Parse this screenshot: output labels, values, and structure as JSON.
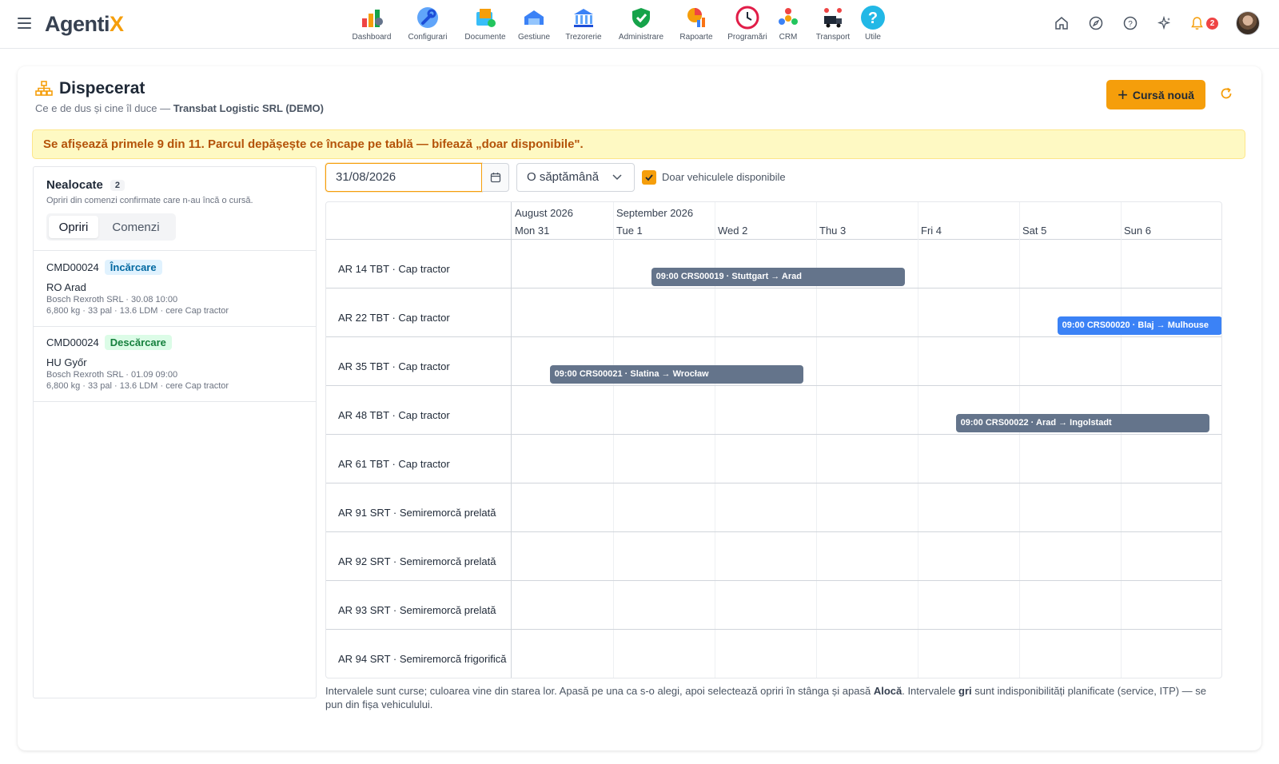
{
  "app": {
    "logo_main": "Agenti",
    "logo_accent": "X"
  },
  "modules": [
    {
      "label": "Dashboard",
      "icon": "dashboard-icon"
    },
    {
      "label": "Configurari",
      "icon": "wrench-icon"
    },
    {
      "label": "Documente",
      "icon": "documents-icon"
    },
    {
      "label": "Gestiune",
      "icon": "warehouse-icon"
    },
    {
      "label": "Trezorerie",
      "icon": "bank-icon"
    },
    {
      "label": "Administrare",
      "icon": "shield-icon"
    },
    {
      "label": "Rapoarte",
      "icon": "reports-icon"
    },
    {
      "label": "Programări",
      "icon": "clock-icon"
    },
    {
      "label": "CRM",
      "icon": "crm-icon"
    },
    {
      "label": "Transport",
      "icon": "truck-icon"
    },
    {
      "label": "Utile",
      "icon": "help-icon"
    }
  ],
  "header": {
    "notifications_count": "2"
  },
  "page": {
    "title": "Dispecerat",
    "subtitle_prefix": "Ce e de dus și cine îl duce — ",
    "subtitle_company": "Transbat Logistic SRL (DEMO)",
    "new_button": "Cursă nouă"
  },
  "warning": "Se afișează primele 9 din 11. Parcul depășește ce încape pe tablă — bifează „doar disponibile\".",
  "unassigned": {
    "title": "Nealocate",
    "count": "2",
    "subtitle": "Opriri din comenzi confirmate care n-au încă o cursă.",
    "tabs": [
      "Opriri",
      "Comenzi"
    ],
    "items": [
      {
        "code": "CMD00024",
        "tag": "Încărcare",
        "place": "RO Arad",
        "line1": "Bosch Rexroth SRL · 30.08 10:00",
        "line2": "6,800 kg · 33 pal · 13.6 LDM · cere Cap tractor"
      },
      {
        "code": "CMD00024",
        "tag": "Descărcare",
        "place": "HU Győr",
        "line1": "Bosch Rexroth SRL · 01.09 09:00",
        "line2": "6,800 kg · 33 pal · 13.6 LDM · cere Cap tractor"
      }
    ]
  },
  "toolbar": {
    "date_value": "31/08/2026",
    "range_value": "O săptămână",
    "available_only_label": "Doar vehiculele disponibile",
    "available_only_checked": true
  },
  "timeline": {
    "months": [
      {
        "label": "August 2026",
        "day_index": 0
      },
      {
        "label": "September 2026",
        "day_index": 1
      }
    ],
    "days": [
      "Mon 31",
      "Tue 1",
      "Wed 2",
      "Thu 3",
      "Fri 4",
      "Sat 5",
      "Sun 6"
    ],
    "vehicles": [
      "AR 14 TBT · Cap tractor",
      "AR 22 TBT · Cap tractor",
      "AR 35 TBT · Cap tractor",
      "AR 48 TBT · Cap tractor",
      "AR 61 TBT · Cap tractor",
      "AR 91 SRT · Semiremorcă prelată",
      "AR 92 SRT · Semiremorcă prelată",
      "AR 93 SRT · Semiremorcă prelată",
      "AR 94 SRT · Semiremorcă frigorifică"
    ],
    "trips": [
      {
        "row": 0,
        "label": "09:00 CRS00019 · Stuttgart → Arad",
        "start_day": 1.375,
        "end_day": 3.875,
        "color": "#64748b"
      },
      {
        "row": 1,
        "label": "09:00 CRS00020 · Blaj → Mulhouse",
        "start_day": 5.375,
        "end_day": 7.0,
        "color": "#3b82f6"
      },
      {
        "row": 2,
        "label": "09:00 CRS00021 · Slatina → Wrocław",
        "start_day": 0.375,
        "end_day": 2.875,
        "color": "#64748b"
      },
      {
        "row": 3,
        "label": "09:00 CRS00022 · Arad → Ingolstadt",
        "start_day": 4.375,
        "end_day": 6.875,
        "color": "#64748b"
      }
    ]
  },
  "footnote": {
    "part1": "Intervalele sunt curse; culoarea vine din starea lor. Apasă pe una ca s-o alegi, apoi selectează opriri în stânga și apasă ",
    "bold1": "Alocă",
    "part2": ". Intervalele ",
    "bold2": "gri",
    "part3": " sunt indisponibilități planificate (service, ITP) — se pun din fișa vehiculului."
  }
}
